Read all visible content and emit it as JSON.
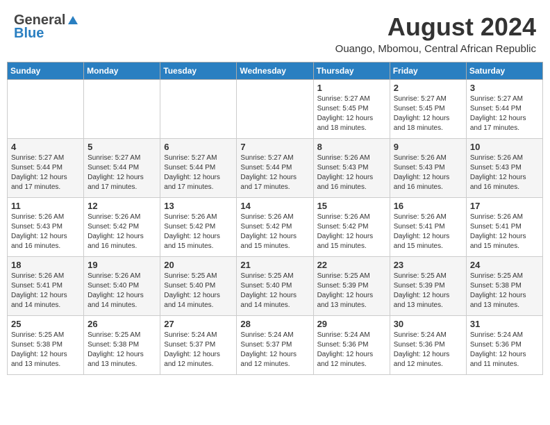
{
  "header": {
    "logo_general": "General",
    "logo_blue": "Blue",
    "month_year": "August 2024",
    "location": "Ouango, Mbomou, Central African Republic"
  },
  "days_of_week": [
    "Sunday",
    "Monday",
    "Tuesday",
    "Wednesday",
    "Thursday",
    "Friday",
    "Saturday"
  ],
  "weeks": [
    [
      {
        "day": "",
        "info": ""
      },
      {
        "day": "",
        "info": ""
      },
      {
        "day": "",
        "info": ""
      },
      {
        "day": "",
        "info": ""
      },
      {
        "day": "1",
        "info": "Sunrise: 5:27 AM\nSunset: 5:45 PM\nDaylight: 12 hours\nand 18 minutes."
      },
      {
        "day": "2",
        "info": "Sunrise: 5:27 AM\nSunset: 5:45 PM\nDaylight: 12 hours\nand 18 minutes."
      },
      {
        "day": "3",
        "info": "Sunrise: 5:27 AM\nSunset: 5:44 PM\nDaylight: 12 hours\nand 17 minutes."
      }
    ],
    [
      {
        "day": "4",
        "info": "Sunrise: 5:27 AM\nSunset: 5:44 PM\nDaylight: 12 hours\nand 17 minutes."
      },
      {
        "day": "5",
        "info": "Sunrise: 5:27 AM\nSunset: 5:44 PM\nDaylight: 12 hours\nand 17 minutes."
      },
      {
        "day": "6",
        "info": "Sunrise: 5:27 AM\nSunset: 5:44 PM\nDaylight: 12 hours\nand 17 minutes."
      },
      {
        "day": "7",
        "info": "Sunrise: 5:27 AM\nSunset: 5:44 PM\nDaylight: 12 hours\nand 17 minutes."
      },
      {
        "day": "8",
        "info": "Sunrise: 5:26 AM\nSunset: 5:43 PM\nDaylight: 12 hours\nand 16 minutes."
      },
      {
        "day": "9",
        "info": "Sunrise: 5:26 AM\nSunset: 5:43 PM\nDaylight: 12 hours\nand 16 minutes."
      },
      {
        "day": "10",
        "info": "Sunrise: 5:26 AM\nSunset: 5:43 PM\nDaylight: 12 hours\nand 16 minutes."
      }
    ],
    [
      {
        "day": "11",
        "info": "Sunrise: 5:26 AM\nSunset: 5:43 PM\nDaylight: 12 hours\nand 16 minutes."
      },
      {
        "day": "12",
        "info": "Sunrise: 5:26 AM\nSunset: 5:42 PM\nDaylight: 12 hours\nand 16 minutes."
      },
      {
        "day": "13",
        "info": "Sunrise: 5:26 AM\nSunset: 5:42 PM\nDaylight: 12 hours\nand 15 minutes."
      },
      {
        "day": "14",
        "info": "Sunrise: 5:26 AM\nSunset: 5:42 PM\nDaylight: 12 hours\nand 15 minutes."
      },
      {
        "day": "15",
        "info": "Sunrise: 5:26 AM\nSunset: 5:42 PM\nDaylight: 12 hours\nand 15 minutes."
      },
      {
        "day": "16",
        "info": "Sunrise: 5:26 AM\nSunset: 5:41 PM\nDaylight: 12 hours\nand 15 minutes."
      },
      {
        "day": "17",
        "info": "Sunrise: 5:26 AM\nSunset: 5:41 PM\nDaylight: 12 hours\nand 15 minutes."
      }
    ],
    [
      {
        "day": "18",
        "info": "Sunrise: 5:26 AM\nSunset: 5:41 PM\nDaylight: 12 hours\nand 14 minutes."
      },
      {
        "day": "19",
        "info": "Sunrise: 5:26 AM\nSunset: 5:40 PM\nDaylight: 12 hours\nand 14 minutes."
      },
      {
        "day": "20",
        "info": "Sunrise: 5:25 AM\nSunset: 5:40 PM\nDaylight: 12 hours\nand 14 minutes."
      },
      {
        "day": "21",
        "info": "Sunrise: 5:25 AM\nSunset: 5:40 PM\nDaylight: 12 hours\nand 14 minutes."
      },
      {
        "day": "22",
        "info": "Sunrise: 5:25 AM\nSunset: 5:39 PM\nDaylight: 12 hours\nand 13 minutes."
      },
      {
        "day": "23",
        "info": "Sunrise: 5:25 AM\nSunset: 5:39 PM\nDaylight: 12 hours\nand 13 minutes."
      },
      {
        "day": "24",
        "info": "Sunrise: 5:25 AM\nSunset: 5:38 PM\nDaylight: 12 hours\nand 13 minutes."
      }
    ],
    [
      {
        "day": "25",
        "info": "Sunrise: 5:25 AM\nSunset: 5:38 PM\nDaylight: 12 hours\nand 13 minutes."
      },
      {
        "day": "26",
        "info": "Sunrise: 5:25 AM\nSunset: 5:38 PM\nDaylight: 12 hours\nand 13 minutes."
      },
      {
        "day": "27",
        "info": "Sunrise: 5:24 AM\nSunset: 5:37 PM\nDaylight: 12 hours\nand 12 minutes."
      },
      {
        "day": "28",
        "info": "Sunrise: 5:24 AM\nSunset: 5:37 PM\nDaylight: 12 hours\nand 12 minutes."
      },
      {
        "day": "29",
        "info": "Sunrise: 5:24 AM\nSunset: 5:36 PM\nDaylight: 12 hours\nand 12 minutes."
      },
      {
        "day": "30",
        "info": "Sunrise: 5:24 AM\nSunset: 5:36 PM\nDaylight: 12 hours\nand 12 minutes."
      },
      {
        "day": "31",
        "info": "Sunrise: 5:24 AM\nSunset: 5:36 PM\nDaylight: 12 hours\nand 11 minutes."
      }
    ]
  ]
}
